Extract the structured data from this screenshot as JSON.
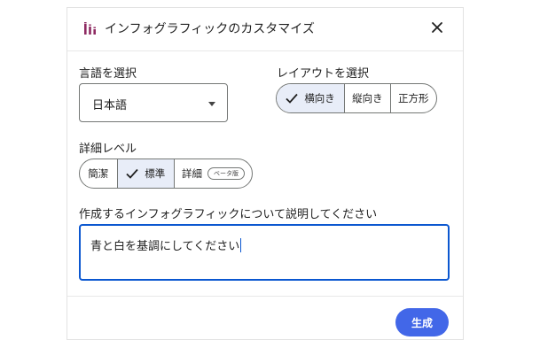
{
  "dialog": {
    "title": "インフォグラフィックのカスタマイズ",
    "icon": "bar-chart-icon",
    "close_icon": "close-icon"
  },
  "language": {
    "label": "言語を選択",
    "selected": "日本語"
  },
  "layout": {
    "label": "レイアウトを選択",
    "options": [
      "横向き",
      "縦向き",
      "正方形"
    ],
    "selected": "横向き"
  },
  "detail": {
    "label": "詳細レベル",
    "options": [
      "簡潔",
      "標準",
      "詳細"
    ],
    "selected": "標準",
    "beta_badge": "ベータ版"
  },
  "description": {
    "label": "作成するインフォグラフィックについて説明してください",
    "value": "青と白を基調にしてください"
  },
  "actions": {
    "generate_label": "生成"
  },
  "colors": {
    "accent": "#0b57d0",
    "button": "#4267e8",
    "selected_segment": "#e8edf8",
    "icon": "#8e2a62"
  }
}
